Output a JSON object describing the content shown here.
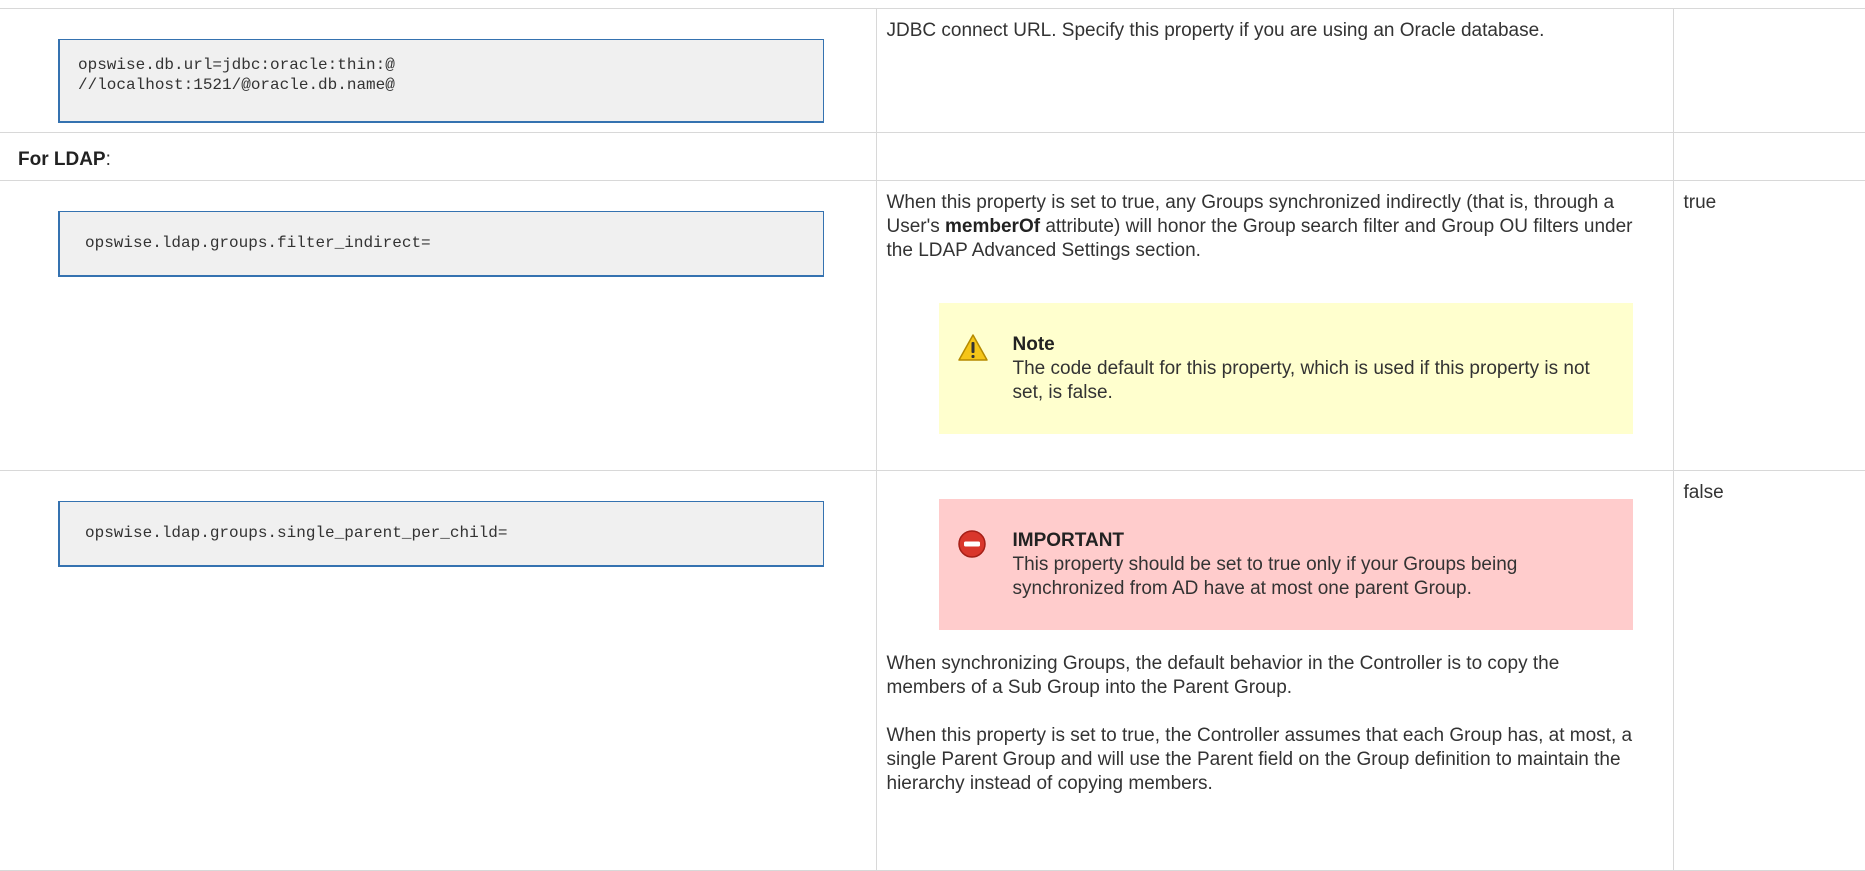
{
  "rows": [
    {
      "property": "opswise.db.url=jdbc:oracle:thin:@\n//localhost:1521/@oracle.db.name@",
      "description": "JDBC connect URL. Specify this property if you are using an Oracle database.",
      "default": ""
    },
    {
      "property": "opswise.ldap.groups.filter_indirect=",
      "description_pre": "When this property is set to true, any Groups synchronized indirectly (that is, through a User's ",
      "description_bold": "memberOf",
      "description_post": " attribute) will honor the Group search filter and Group OU filters under the LDAP Advanced Settings section.",
      "default": "true",
      "panel": {
        "type": "note",
        "icon": "warning-icon",
        "title": "Note",
        "text": "The code default for this property, which is used if this property is not set, is false.",
        "color": "#ffffce"
      }
    },
    {
      "property": "opswise.ldap.groups.single_parent_per_child=",
      "default": "false",
      "panel": {
        "type": "important",
        "icon": "error-icon",
        "title": "IMPORTANT",
        "text": "This property should be set to true only if your Groups being synchronized from AD have at most one parent Group.",
        "color": "#ffcccc"
      },
      "paragraph1": "When synchronizing Groups, the default behavior in the Controller is to copy the members of a Sub Group into the Parent Group.",
      "paragraph2": "When this property is set to true, the Controller assumes that each Group has, at most, a single Parent Group and will use the Parent field on the Group definition to maintain the hierarchy instead of copying members."
    }
  ],
  "section": {
    "label_bold": "For LDAP",
    "label_suffix": ":"
  },
  "colors": {
    "code_border": "#3572b0",
    "code_background": "#f0f0f0",
    "table_border": "#d8d8d8"
  }
}
